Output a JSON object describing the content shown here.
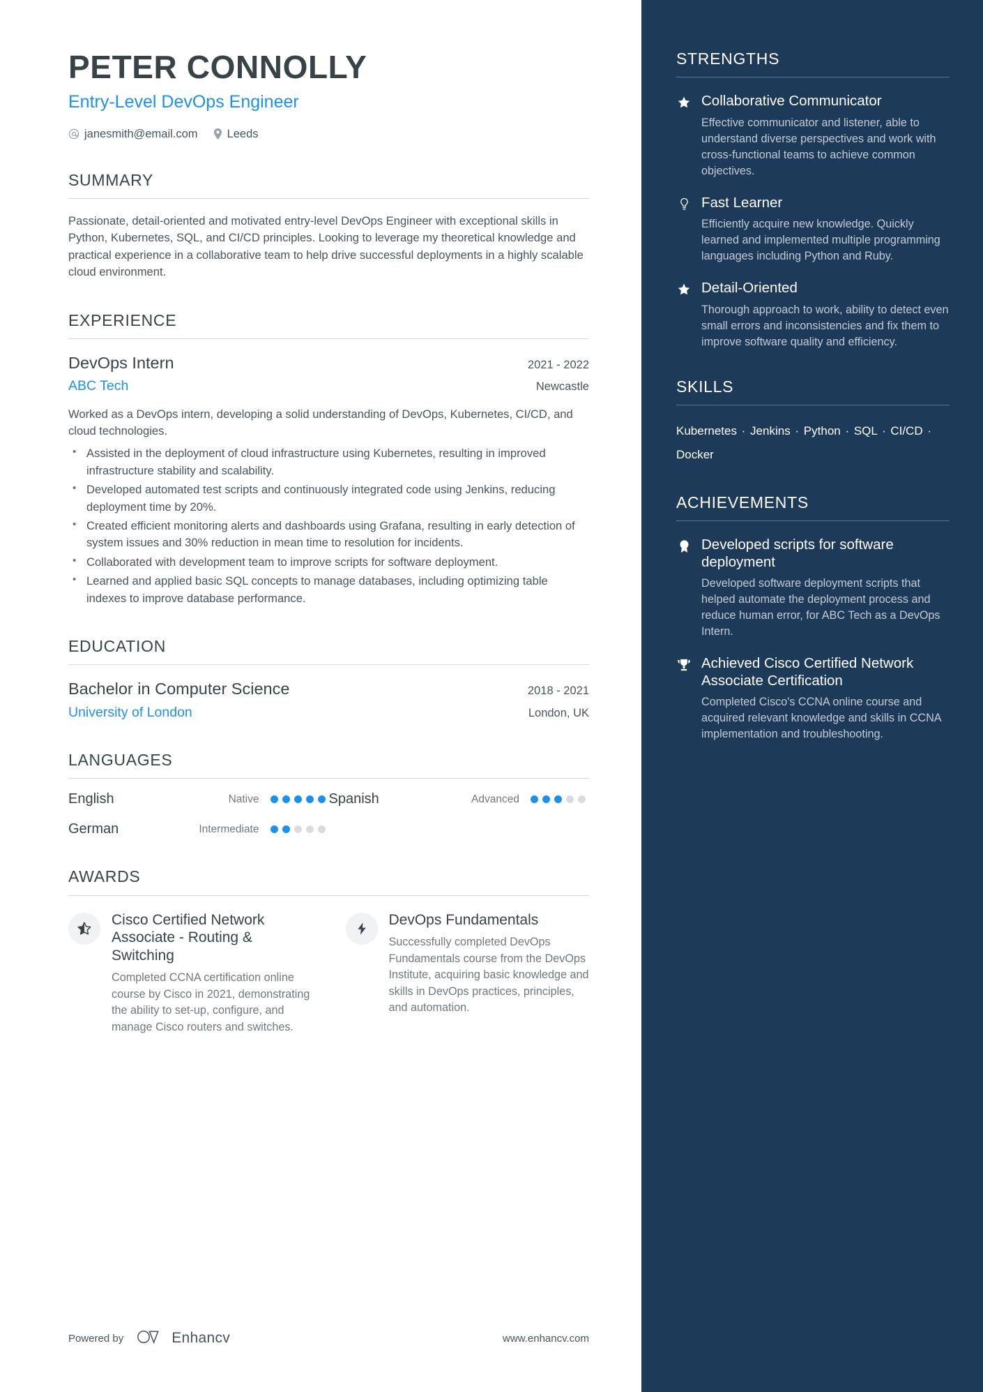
{
  "header": {
    "name": "PETER CONNOLLY",
    "job_title": "Entry-Level DevOps Engineer",
    "email": "janesmith@email.com",
    "location": "Leeds",
    "email_icon": "at-sign-icon",
    "location_icon": "location-pin-icon"
  },
  "summary": {
    "heading": "SUMMARY",
    "text": "Passionate, detail-oriented and motivated entry-level DevOps Engineer with exceptional skills in Python, Kubernetes, SQL, and CI/CD principles. Looking to leverage my theoretical knowledge and practical experience in a collaborative team to help drive successful deployments in a highly scalable cloud environment."
  },
  "experience": {
    "heading": "EXPERIENCE",
    "entries": [
      {
        "role": "DevOps Intern",
        "dates": "2021 - 2022",
        "organization": "ABC Tech",
        "location": "Newcastle",
        "description": "Worked as a DevOps intern, developing a solid understanding of DevOps, Kubernetes, CI/CD, and cloud technologies.",
        "bullets": [
          "Assisted in the deployment of cloud infrastructure using Kubernetes, resulting in improved infrastructure stability and scalability.",
          "Developed automated test scripts and continuously integrated code using Jenkins, reducing deployment time by 20%.",
          "Created efficient monitoring alerts and dashboards using Grafana, resulting in early detection of system issues and 30% reduction in mean time to resolution for incidents.",
          "Collaborated with development team to improve scripts for software deployment.",
          "Learned and applied basic SQL concepts to manage databases, including optimizing table indexes to improve database performance."
        ]
      }
    ]
  },
  "education": {
    "heading": "EDUCATION",
    "entries": [
      {
        "degree": "Bachelor in Computer Science",
        "dates": "2018 - 2021",
        "organization": "University of London",
        "location": "London, UK"
      }
    ]
  },
  "languages": {
    "heading": "LANGUAGES",
    "items": [
      {
        "name": "English",
        "level": "Native",
        "filled": 5,
        "total": 5
      },
      {
        "name": "Spanish",
        "level": "Advanced",
        "filled": 3,
        "total": 5
      },
      {
        "name": "German",
        "level": "Intermediate",
        "filled": 2,
        "total": 5
      }
    ]
  },
  "awards": {
    "heading": "AWARDS",
    "items": [
      {
        "icon": "star-outline-icon",
        "title": "Cisco Certified Network Associate - Routing & Switching",
        "description": "Completed CCNA certification online course by Cisco in 2021, demonstrating the ability to set-up, configure, and manage Cisco routers and switches."
      },
      {
        "icon": "lightning-bolt-icon",
        "title": "DevOps Fundamentals",
        "description": "Successfully completed DevOps Fundamentals course from the DevOps Institute, acquiring basic knowledge and skills in DevOps practices, principles, and automation."
      }
    ]
  },
  "strengths": {
    "heading": "STRENGTHS",
    "items": [
      {
        "icon": "star-icon",
        "title": "Collaborative Communicator",
        "description": "Effective communicator and listener, able to understand diverse perspectives and work with cross-functional teams to achieve common objectives."
      },
      {
        "icon": "lightbulb-icon",
        "title": "Fast Learner",
        "description": "Efficiently acquire new knowledge. Quickly learned and implemented multiple programming languages including Python and Ruby."
      },
      {
        "icon": "star-icon",
        "title": "Detail-Oriented",
        "description": "Thorough approach to work, ability to detect even small errors and inconsistencies and fix them to improve software quality and efficiency."
      }
    ]
  },
  "skills": {
    "heading": "SKILLS",
    "text": "Kubernetes · Jenkins · Python · SQL · CI/CD · Docker"
  },
  "achievements": {
    "heading": "ACHIEVEMENTS",
    "items": [
      {
        "icon": "badge-icon",
        "title": "Developed scripts for software deployment",
        "description": "Developed software deployment scripts that helped automate the deployment process and reduce human error, for ABC Tech as a DevOps Intern."
      },
      {
        "icon": "trophy-icon",
        "title": "Achieved Cisco Certified Network Associate Certification",
        "description": "Completed Cisco's CCNA online course and acquired relevant knowledge and skills in CCNA implementation and troubleshooting."
      }
    ]
  },
  "footer": {
    "powered_by": "Powered by",
    "brand": "Enhancv",
    "website": "www.enhancv.com",
    "brand_icon": "enhancv-logo-icon"
  },
  "colors": {
    "accent_blue": "#1a91f0",
    "sidebar_bg": "#1d3a59",
    "heading_dark": "#384347",
    "body_text": "#4a545a"
  }
}
